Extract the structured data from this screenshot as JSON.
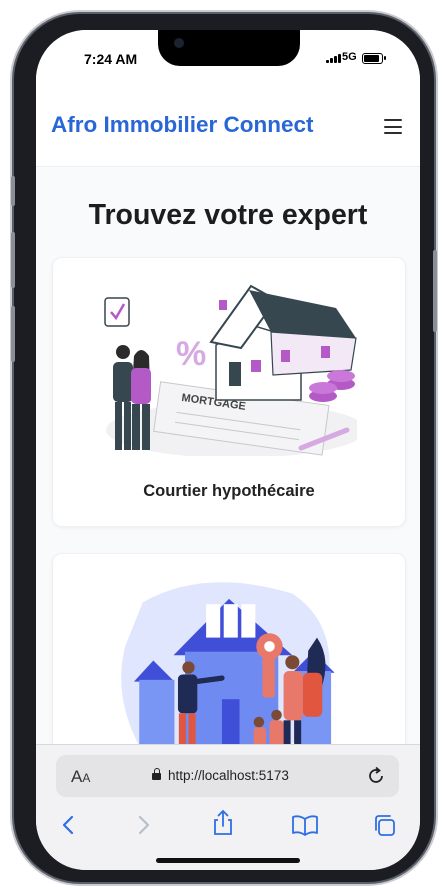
{
  "status_bar": {
    "time": "7:24 AM",
    "network": "5G"
  },
  "navbar": {
    "brand": "Afro Immobilier Connect",
    "menu_icon": "hamburger-menu-icon"
  },
  "main": {
    "title": "Trouvez votre expert",
    "cards": [
      {
        "title": "Courtier hypothécaire",
        "illustration_text": "MORTGAGE",
        "illustration": "mortgage-house-couple-illustration"
      },
      {
        "title": "",
        "illustration": "house-key-family-illustration"
      }
    ]
  },
  "browser": {
    "text_size_label": "A",
    "text_size_label_small": "A",
    "url": "http://localhost:5173",
    "icons": [
      "lock-icon",
      "reload-icon",
      "back-icon",
      "forward-icon",
      "share-icon",
      "bookmarks-icon",
      "tabs-icon"
    ]
  },
  "colors": {
    "brand": "#2a67d6",
    "illustration_accent": "#b35ac7",
    "illustration_blue": "#5f7cf0",
    "illustration_dark": "#37474f"
  }
}
